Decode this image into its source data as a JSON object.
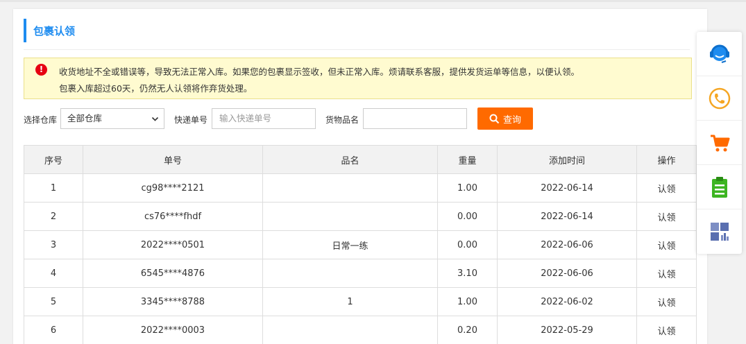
{
  "page": {
    "title": "包裹认领"
  },
  "notice": {
    "line1": "收货地址不全或错误等，导致无法正常入库。如果您的包裹显示签收，但未正常入库。烦请联系客服，提供发货运单等信息，以便认领。",
    "line2": "包裹入库超过60天，仍然无人认领将作弃货处理。"
  },
  "filters": {
    "warehouse_label": "选择仓库",
    "warehouse_value": "全部仓库",
    "tracking_label": "快递单号",
    "tracking_placeholder": "输入快递单号",
    "tracking_value": "",
    "goods_label": "货物品名",
    "goods_value": "",
    "search_label": "查询"
  },
  "table": {
    "headers": [
      "序号",
      "单号",
      "品名",
      "重量",
      "添加时间",
      "操作"
    ],
    "rows": [
      [
        "1",
        "cg98****2121",
        "",
        "1.00",
        "2022-06-14",
        "认领"
      ],
      [
        "2",
        "cs76****fhdf",
        "",
        "0.00",
        "2022-06-14",
        "认领"
      ],
      [
        "3",
        "2022****0501",
        "日常一练",
        "0.00",
        "2022-06-06",
        "认领"
      ],
      [
        "4",
        "6545****4876",
        "",
        "3.10",
        "2022-06-06",
        "认领"
      ],
      [
        "5",
        "3345****8788",
        "1",
        "1.00",
        "2022-06-02",
        "认领"
      ],
      [
        "6",
        "2022****0003",
        "",
        "0.20",
        "2022-05-29",
        "认领"
      ]
    ]
  },
  "sidebar": {
    "items": [
      {
        "icon": "customer-service-icon",
        "color": "#1e8cf0"
      },
      {
        "icon": "phone-icon",
        "color": "#f5a623"
      },
      {
        "icon": "cart-icon",
        "color": "#ff6a00"
      },
      {
        "icon": "clipboard-icon",
        "color": "#3cb521"
      },
      {
        "icon": "dashboard-icon",
        "color": "#5a6fb0"
      }
    ]
  },
  "colors": {
    "accent": "#1e8cf0",
    "search_button": "#ff6a00",
    "notice_bg": "#fffbd0",
    "alert": "#e60012"
  }
}
